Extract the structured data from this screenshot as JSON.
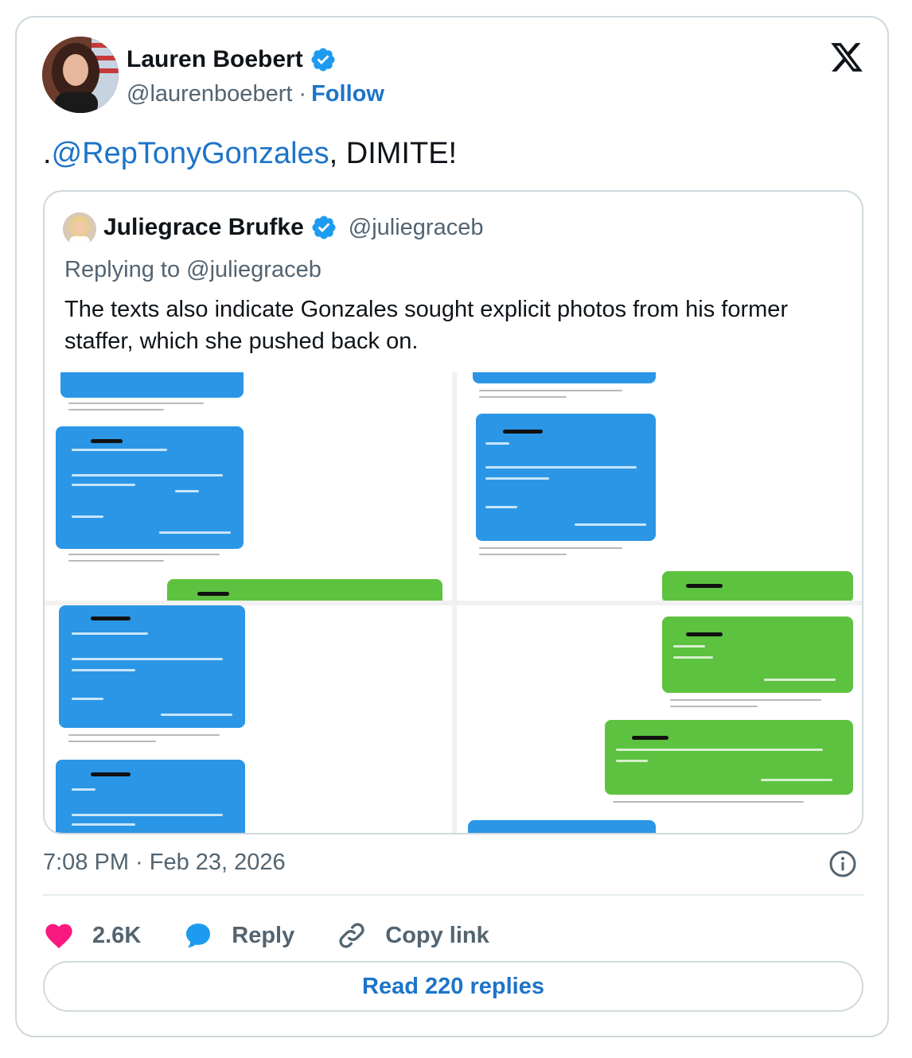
{
  "author": {
    "name": "Lauren Boebert",
    "handle": "@laurenboebert",
    "separator": "·",
    "follow_label": "Follow"
  },
  "tweet": {
    "prefix": ".",
    "mention": "@RepTonyGonzales",
    "suffix": ", DIMITE!"
  },
  "quoted": {
    "name": "Juliegrace Brufke",
    "handle": "@juliegraceb",
    "replying_to": "Replying to @juliegraceb",
    "text": "The texts also indicate Gonzales sought explicit photos from his former staffer, which she pushed back on."
  },
  "timestamp": "7:08 PM · Feb 23, 2026",
  "actions": {
    "like_count": "2.6K",
    "reply_label": "Reply",
    "copy_label": "Copy link"
  },
  "read_replies_label": "Read 220 replies",
  "icons": {
    "verified": "verified-badge-icon",
    "x_logo": "x-logo-icon",
    "info": "info-icon",
    "like": "heart-icon",
    "reply": "speech-bubble-icon",
    "copy": "link-icon"
  },
  "colors": {
    "link_blue": "#1d74c9",
    "muted_text": "#536471",
    "like_red": "#f91880",
    "reply_blue": "#1d9bf0",
    "imessage_blue": "#2b96e5",
    "sms_green": "#5dc240"
  }
}
